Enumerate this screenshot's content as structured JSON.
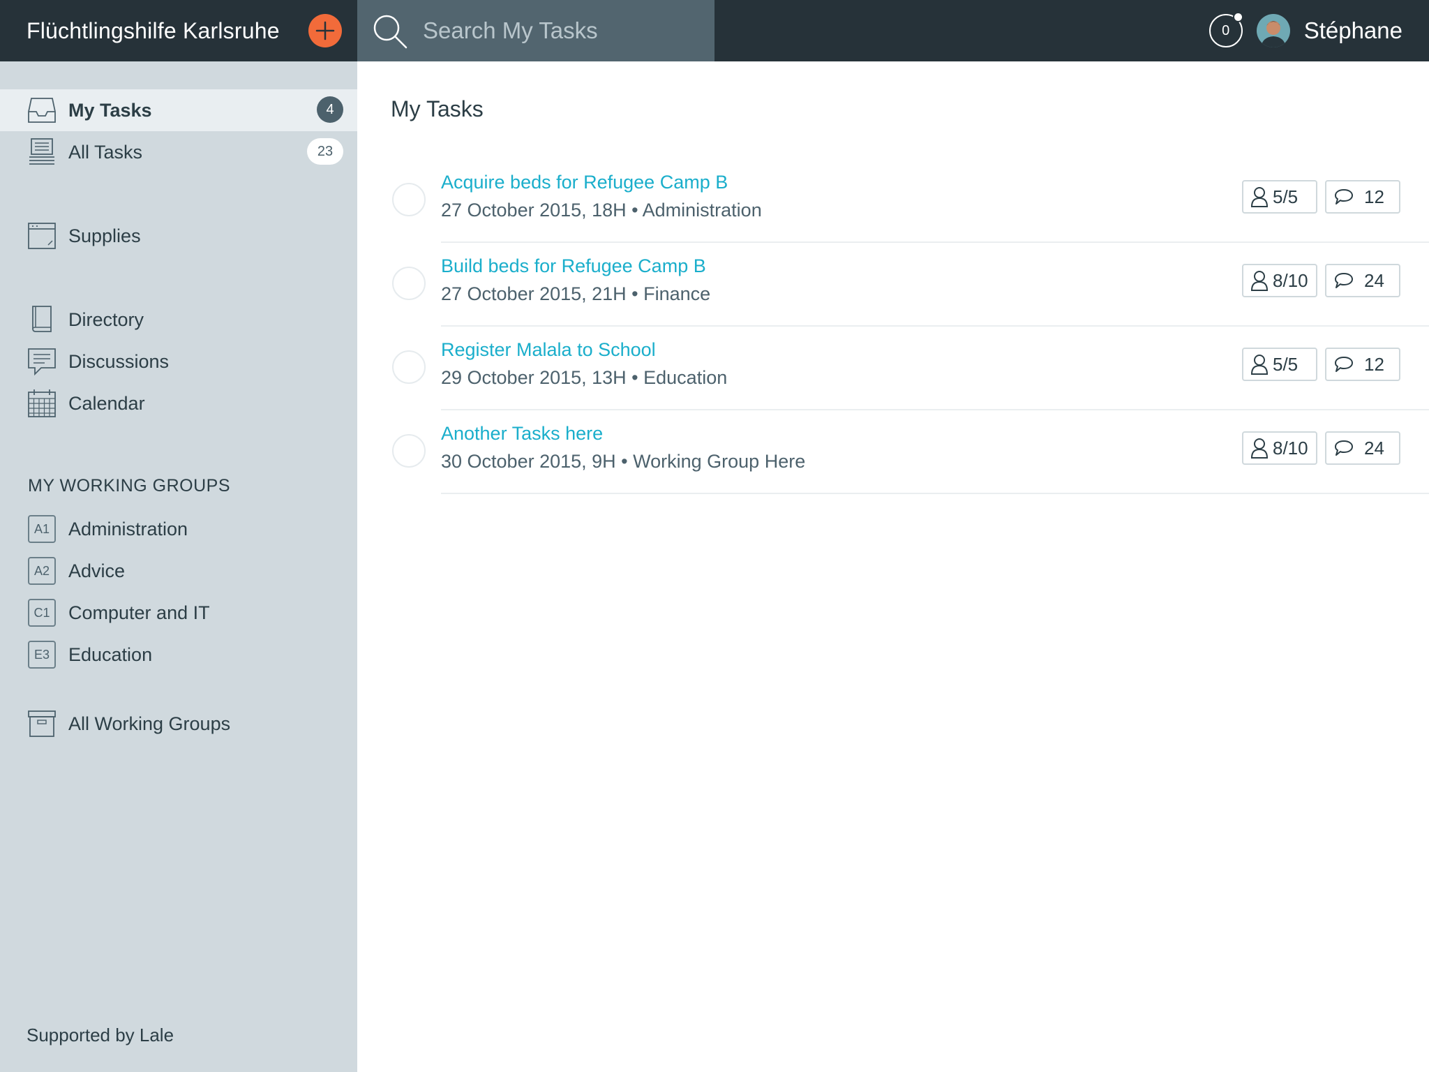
{
  "header": {
    "org_name": "Flüchtlingshilfe Karlsruhe",
    "search_placeholder": "Search My Tasks",
    "notification_count": "0",
    "user_name": "Stéphane"
  },
  "sidebar": {
    "items": [
      {
        "label": "My Tasks",
        "count": "4",
        "icon": "inbox-icon"
      },
      {
        "label": "All Tasks",
        "count": "23",
        "icon": "stack-icon"
      },
      {
        "label": "Supplies",
        "icon": "box-icon"
      },
      {
        "label": "Directory",
        "icon": "book-icon"
      },
      {
        "label": "Discussions",
        "icon": "chat-icon"
      },
      {
        "label": "Calendar",
        "icon": "calendar-icon"
      }
    ],
    "groups_header": "MY WORKING GROUPS",
    "groups": [
      {
        "code": "A1",
        "label": "Administration"
      },
      {
        "code": "A2",
        "label": "Advice"
      },
      {
        "code": "C1",
        "label": "Computer and IT"
      },
      {
        "code": "E3",
        "label": "Education"
      }
    ],
    "all_groups_label": "All Working Groups",
    "footer": "Supported by Lale"
  },
  "main": {
    "title": "My Tasks",
    "tasks": [
      {
        "title": "Acquire beds for Refugee Camp B",
        "meta": "27 October 2015, 18H • Administration",
        "members": "5/5",
        "comments": "12"
      },
      {
        "title": "Build beds for Refugee Camp B",
        "meta": "27 October 2015, 21H • Finance",
        "members": "8/10",
        "comments": "24"
      },
      {
        "title": "Register Malala to School",
        "meta": "29 October 2015, 13H • Education",
        "members": "5/5",
        "comments": "12"
      },
      {
        "title": "Another Tasks here",
        "meta": "30 October 2015, 9H • Working Group Here",
        "members": "8/10",
        "comments": "24"
      }
    ]
  },
  "colors": {
    "topbar": "#263239",
    "search_bg": "#52656f",
    "accent_orange": "#f26b3a",
    "link_teal": "#1aaecb",
    "sidebar_bg": "#d0d9de"
  }
}
